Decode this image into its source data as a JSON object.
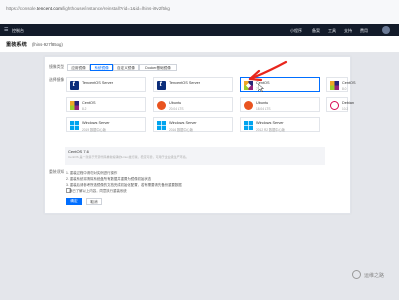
{
  "browser": {
    "url_prefix": "https://console.",
    "url_host": "tencent.com",
    "url_path": "/lighthouse/instance/reinstall?rid=1&id=lhins-i9v2f5kg"
  },
  "topnav": {
    "left_text": "控制台",
    "right_items": [
      "小程序",
      "备案",
      "工具",
      "支持",
      "费用"
    ]
  },
  "subhead": {
    "title": "重装系统",
    "subtitle": "(lhins-9z7f85og)"
  },
  "form": {
    "image_type_label": "镜像类型",
    "image_tabs": [
      {
        "label": "应用镜像",
        "selected": false
      },
      {
        "label": "系统镜像",
        "selected": true
      },
      {
        "label": "自定义镜像",
        "selected": false
      },
      {
        "label": "Docker基础镜像",
        "selected": false
      }
    ],
    "os_label": "选择镜像",
    "os_images": [
      {
        "name": "TencentOS Server",
        "version": "",
        "logo": "tencent-logo-icon",
        "selected": false
      },
      {
        "name": "TencentOS Server",
        "version": "",
        "logo": "tencent-logo-icon",
        "selected": false
      },
      {
        "name": "CentOS",
        "version": "7.6",
        "logo": "centos-logo-icon",
        "selected": true
      },
      {
        "name": "CentOS",
        "version": "8.0",
        "logo": "centos-logo-icon",
        "selected": false
      },
      {
        "name": "CentOS",
        "version": "8.2",
        "logo": "centos-logo-icon",
        "selected": false
      },
      {
        "name": "Ubuntu",
        "version": "20.04 LTS",
        "logo": "ubuntu-logo-icon",
        "selected": false
      },
      {
        "name": "Ubuntu",
        "version": "18.04 LTS",
        "logo": "ubuntu-logo-icon",
        "selected": false
      },
      {
        "name": "Debian",
        "version": "10.2",
        "logo": "debian-logo-icon",
        "selected": false
      },
      {
        "name": "Windows Server",
        "version": "2019 数据中心版",
        "logo": "windows-logo-icon",
        "selected": false
      },
      {
        "name": "Windows Server",
        "version": "2016 数据中心版",
        "logo": "windows-logo-icon",
        "selected": false
      },
      {
        "name": "Windows Server",
        "version": "2012 R2 数据中心版",
        "logo": "windows-logo-icon",
        "selected": false
      }
    ],
    "selected_desc_title": "CentOS 7.6",
    "selected_desc_text": "CentOS 是一款基于开源代码重新编译的Linux发行版，稳定可靠，可用于企业级生产环境。",
    "notes_label": "重装须知",
    "notes": [
      "1. 重装过程中请勿对实例进行操作",
      "2. 重装系统将清除系统盘所有数据并重置为镜像初始状态",
      "3. 重装后请参考所选镜像的文档完成初始化配置，若有需要请先备份重要数据",
      "   我已了解以上内容，同意执行重装系统"
    ],
    "confirm_label": "确定",
    "cancel_label": "取消"
  },
  "watermark": "运维之路"
}
